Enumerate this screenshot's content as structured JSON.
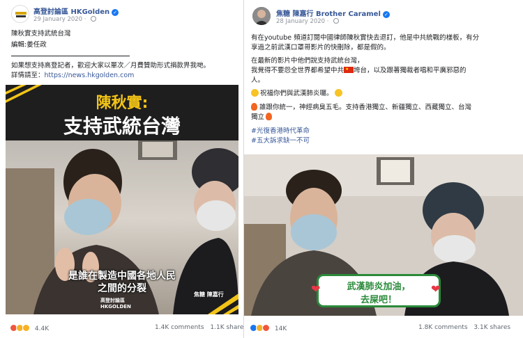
{
  "left_post": {
    "page_name": "高登討論區 HKGolden",
    "avatar_text": "高登討論區",
    "date": "29 January 2020 · ",
    "body": [
      "陳秋實支持武統台灣",
      "編輯:姜任政"
    ],
    "footer_note": [
      "如果想支持高登記者，歡迎大家以單次／月費贊助形式捐款畀我哋。",
      "詳情請至："
    ],
    "footer_link": "https://news.hkgolden.com",
    "video": {
      "title_line1": "陳秋實:",
      "title_line2": "支持武統台灣",
      "subtitle_line1": "是誰在製造中國各地人民",
      "subtitle_line2": "之間的分裂",
      "credit": "焦糖 陳嘉行",
      "logo_line1": "高登討論區",
      "logo_line2": "HKGOLDEN"
    },
    "reactions_count": "4.4K",
    "comments": "1.4K comments",
    "shares": "1.1K shares"
  },
  "right_post": {
    "page_name": "焦糖 陳嘉行 Brother Caramel",
    "date": "28 January 2020 · ",
    "body": [
      "有在youtube 頻道訂閱中國律師陳秋實快去退訂，他是中共統戰的樣板，有分",
      "享過之前武漢口罩哥影片的快刪除，都是假的。",
      "在最新的影片中他們說支持武統台灣，",
      "我覺得不要怨全世界都希望中共",
      "垮台，以及跟著獨裁者唱和平廣邪惡的",
      "人。",
      "祝福你們與武漢肺炎囉。",
      "誰跟你統一，神經病臭五毛。支持香港獨立、新疆獨立、西藏獨立、台灣",
      "獨立"
    ],
    "hashtags": [
      "#光復香港時代革命",
      "#五大訴求缺一不可"
    ],
    "video": {
      "caption_line1": "武漢肺炎加油，",
      "caption_line2": "去屎吧！"
    },
    "reactions_count": "14K",
    "comments": "1.8K comments",
    "shares": "3.1K shares"
  },
  "colors": {
    "link": "#385898",
    "verified": "#1877f2",
    "video_banner_bg": "#1e1e1e",
    "stripe_yellow": "#f2c417",
    "caption_green": "#2a8a3a"
  }
}
